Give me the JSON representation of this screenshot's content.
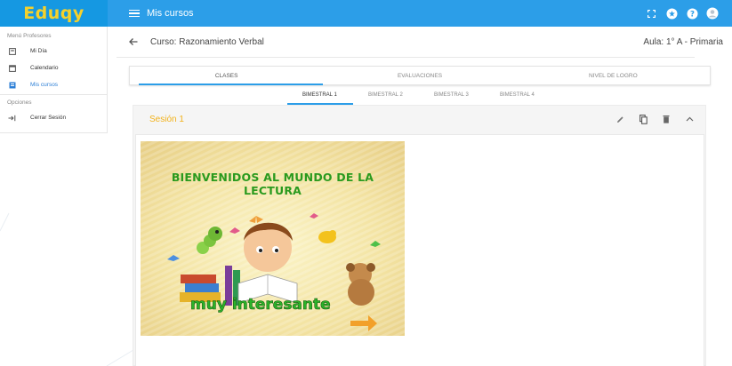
{
  "app": {
    "logo": "Eduqy",
    "page_title": "Mis cursos"
  },
  "topbar_icons": [
    "fullscreen-icon",
    "star-icon",
    "help-icon",
    "user-avatar-icon"
  ],
  "sidebar": {
    "section_profesores": "Menú Profesores",
    "items": [
      {
        "label": "Mi Día",
        "icon": "daily-icon",
        "active": false
      },
      {
        "label": "Calendario",
        "icon": "calendar-icon",
        "active": false
      },
      {
        "label": "Mis cursos",
        "icon": "courses-icon",
        "active": true
      }
    ],
    "section_opciones": "Opciones",
    "logout_label": "Cerrar Sesión"
  },
  "course": {
    "title": "Curso: Razonamiento Verbal",
    "aula": "Aula: 1° A - Primaria"
  },
  "tabs": [
    {
      "label": "CLASES",
      "active": true
    },
    {
      "label": "EVALUACIONES",
      "active": false
    },
    {
      "label": "NIVEL DE LOGRO",
      "active": false
    }
  ],
  "subtabs": [
    {
      "label": "BIMESTRAL 1",
      "active": true
    },
    {
      "label": "BIMESTRAL 2",
      "active": false
    },
    {
      "label": "BIMESTRAL 3",
      "active": false
    },
    {
      "label": "BIMESTRAL 4",
      "active": false
    }
  ],
  "session": {
    "title": "Sesión 1",
    "actions": [
      "edit-icon",
      "copy-icon",
      "delete-icon",
      "collapse-icon"
    ]
  },
  "lesson_image": {
    "heading_line1": "BIENVENIDOS AL MUNDO DE LA",
    "heading_line2": "LECTURA",
    "slogan": "muy interesante"
  },
  "colors": {
    "topbar": "#2c9ee8",
    "logo": "#f6d12a",
    "accent": "#2c9ee8",
    "session_title": "#f2b21b",
    "heading_green": "#2a9a1e"
  }
}
